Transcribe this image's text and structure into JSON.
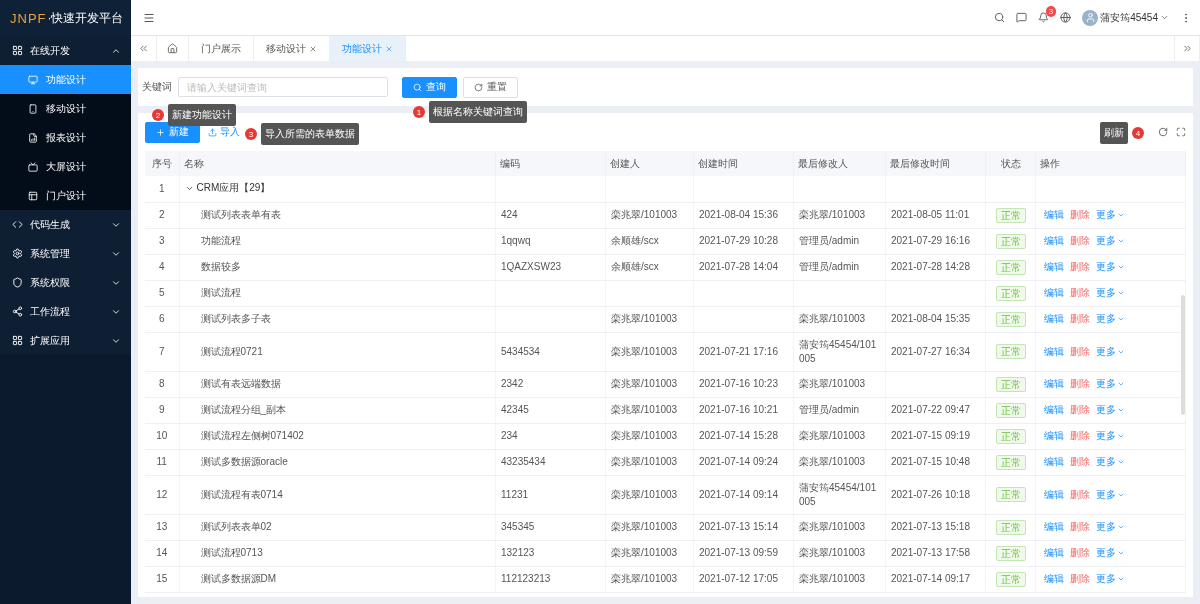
{
  "logo": {
    "mark": "JNPF",
    "text": "·快速开发平台"
  },
  "sidebar": [
    {
      "label": "在线开发",
      "expanded": true,
      "children": [
        {
          "label": "功能设计",
          "selected": true
        },
        {
          "label": "移动设计",
          "selected": false
        },
        {
          "label": "报表设计",
          "selected": false
        },
        {
          "label": "大屏设计",
          "selected": false
        },
        {
          "label": "门户设计",
          "selected": false
        }
      ]
    },
    {
      "label": "代码生成",
      "expanded": false
    },
    {
      "label": "系统管理",
      "expanded": false
    },
    {
      "label": "系统权限",
      "expanded": false
    },
    {
      "label": "工作流程",
      "expanded": false
    },
    {
      "label": "扩展应用",
      "expanded": false
    }
  ],
  "header": {
    "notification_count": "3",
    "user": "蒲安筠45454"
  },
  "tabs": [
    {
      "label": "门户展示",
      "closable": false,
      "selected": false
    },
    {
      "label": "移动设计",
      "closable": true,
      "selected": false
    },
    {
      "label": "功能设计",
      "closable": true,
      "selected": true
    }
  ],
  "search": {
    "label": "关键词",
    "placeholder": "请输入关键词查询",
    "buttons": [
      {
        "kind": "primary",
        "label": "查询"
      },
      {
        "kind": "default",
        "label": "重置"
      }
    ]
  },
  "toolbar": {
    "new_label": "新建",
    "import_label": "导入"
  },
  "guides": [
    {
      "number": "2",
      "text": "新建功能设计"
    },
    {
      "number": "1",
      "text": "根据名称关键词查询"
    },
    {
      "number": "3",
      "text": "导入所需的表单数据"
    },
    {
      "number": "4",
      "text": "刷新"
    }
  ],
  "table": {
    "columns": [
      "序号",
      "名称",
      "编码",
      "创建人",
      "创建时间",
      "最后修改人",
      "最后修改时间",
      "状态",
      "操作"
    ],
    "rows": [
      {
        "kind": "group",
        "index": "1",
        "name": "CRM应用【29】",
        "expanded": true
      },
      {
        "kind": "item",
        "index": "2",
        "name": "测试列表表单有表",
        "code": "424",
        "creator": "栾兆翠/101003",
        "created": "2021-08-04 15:36",
        "modifier": "栾兆翠/101003",
        "modified": "2021-08-05 11:01",
        "status": "正常",
        "actions": [
          "编辑",
          "删除",
          "更多"
        ]
      },
      {
        "kind": "item",
        "index": "3",
        "name": "功能流程",
        "code": "1qqwq",
        "creator": "余顺雄/scx",
        "created": "2021-07-29 10:28",
        "modifier": "管理员/admin",
        "modified": "2021-07-29 16:16",
        "status": "正常",
        "actions": [
          "编辑",
          "删除",
          "更多"
        ]
      },
      {
        "kind": "item",
        "index": "4",
        "name": "数据较多",
        "code": "1QAZXSW23",
        "creator": "余顺雄/scx",
        "created": "2021-07-28 14:04",
        "modifier": "管理员/admin",
        "modified": "2021-07-28 14:28",
        "status": "正常",
        "actions": [
          "编辑",
          "删除",
          "更多"
        ]
      },
      {
        "kind": "item",
        "index": "5",
        "name": "测试流程",
        "status": "正常",
        "actions": [
          "编辑",
          "删除",
          "更多"
        ]
      },
      {
        "kind": "item",
        "index": "6",
        "name": "测试列表多子表",
        "creator": "栾兆翠/101003",
        "modifier": "栾兆翠/101003",
        "modified": "2021-08-04 15:35",
        "status": "正常",
        "actions": [
          "编辑",
          "删除",
          "更多"
        ]
      },
      {
        "kind": "item",
        "index": "7",
        "name": "测试流程0721",
        "code": "5434534",
        "creator": "栾兆翠/101003",
        "created": "2021-07-21 17:16",
        "modifier": "蒲安筠45454/101005",
        "modified": "2021-07-27 16:34",
        "status": "正常",
        "actions": [
          "编辑",
          "删除",
          "更多"
        ]
      },
      {
        "kind": "item",
        "index": "8",
        "name": "测试有表远端数据",
        "code": "2342",
        "creator": "栾兆翠/101003",
        "created": "2021-07-16 10:23",
        "modifier": "栾兆翠/101003",
        "status": "正常",
        "actions": [
          "编辑",
          "删除",
          "更多"
        ]
      },
      {
        "kind": "item",
        "index": "9",
        "name": "测试流程分组_副本",
        "code": "42345",
        "creator": "栾兆翠/101003",
        "created": "2021-07-16 10:21",
        "modifier": "管理员/admin",
        "modified": "2021-07-22 09:47",
        "status": "正常",
        "actions": [
          "编辑",
          "删除",
          "更多"
        ]
      },
      {
        "kind": "item",
        "index": "10",
        "name": "测试流程左侧树071402",
        "code": "234",
        "creator": "栾兆翠/101003",
        "created": "2021-07-14 15:28",
        "modifier": "栾兆翠/101003",
        "modified": "2021-07-15 09:19",
        "status": "正常",
        "actions": [
          "编辑",
          "删除",
          "更多"
        ]
      },
      {
        "kind": "item",
        "index": "11",
        "name": "测试多数据源oracle",
        "code": "43235434",
        "creator": "栾兆翠/101003",
        "created": "2021-07-14 09:24",
        "modifier": "栾兆翠/101003",
        "modified": "2021-07-15 10:48",
        "status": "正常",
        "actions": [
          "编辑",
          "删除",
          "更多"
        ]
      },
      {
        "kind": "item",
        "index": "12",
        "name": "测试流程有表0714",
        "code": "11231",
        "creator": "栾兆翠/101003",
        "created": "2021-07-14 09:14",
        "modifier": "蒲安筠45454/101005",
        "modified": "2021-07-26 10:18",
        "status": "正常",
        "actions": [
          "编辑",
          "删除",
          "更多"
        ]
      },
      {
        "kind": "item",
        "index": "13",
        "name": "测试列表表单02",
        "code": "345345",
        "creator": "栾兆翠/101003",
        "created": "2021-07-13 15:14",
        "modifier": "栾兆翠/101003",
        "modified": "2021-07-13 15:18",
        "status": "正常",
        "actions": [
          "编辑",
          "删除",
          "更多"
        ]
      },
      {
        "kind": "item",
        "index": "14",
        "name": "测试流程0713",
        "code": "132123",
        "creator": "栾兆翠/101003",
        "created": "2021-07-13 09:59",
        "modifier": "栾兆翠/101003",
        "modified": "2021-07-13 17:58",
        "status": "正常",
        "actions": [
          "编辑",
          "删除",
          "更多"
        ]
      },
      {
        "kind": "item",
        "index": "15",
        "name": "测试多数据源DM",
        "code": "112123213",
        "creator": "栾兆翠/101003",
        "created": "2021-07-12 17:05",
        "modifier": "栾兆翠/101003",
        "modified": "2021-07-14 09:17",
        "status": "正常",
        "actions": [
          "编辑",
          "删除",
          "更多"
        ]
      }
    ]
  }
}
